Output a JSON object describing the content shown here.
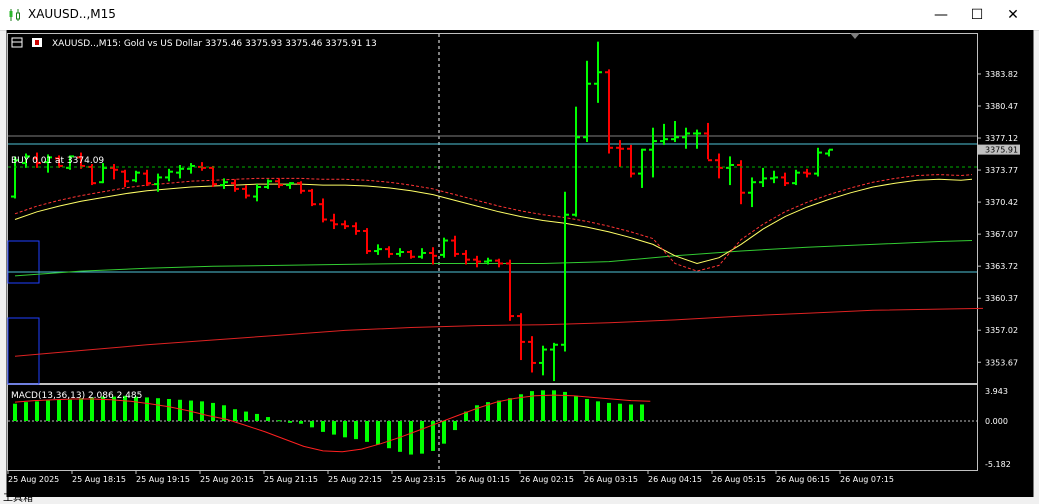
{
  "window": {
    "title": "XAUUSD..,M15",
    "minimize_label": "—",
    "maximize_label": "☐",
    "close_label": "✕"
  },
  "chart_header": {
    "symbol_line": "XAUUSD..,M15:  Gold vs US Dollar  3375.46 3375.93 3375.46 3375.91  13"
  },
  "trade_line": {
    "label": "BUY 0.01 at 3374.09",
    "price": 3374.09
  },
  "current_price_label": "3375.91",
  "price_axis_ticks": [
    "3383.82",
    "3380.47",
    "3377.12",
    "3373.77",
    "3370.42",
    "3367.07",
    "3363.72",
    "3360.37",
    "3357.02",
    "3353.67"
  ],
  "macd": {
    "label": "MACD(13,36,13) 2.086 2.485",
    "axis_ticks": [
      "3.943",
      "0.000",
      "-5.182"
    ]
  },
  "time_axis_ticks": [
    "25 Aug 2025",
    "25 Aug 18:15",
    "25 Aug 19:15",
    "25 Aug 20:15",
    "25 Aug 21:15",
    "25 Aug 22:15",
    "25 Aug 23:15",
    "26 Aug 01:15",
    "26 Aug 02:15",
    "26 Aug 03:15",
    "26 Aug 04:15",
    "26 Aug 05:15",
    "26 Aug 06:15",
    "26 Aug 07:15"
  ],
  "bottom_bar_text": "工具箱",
  "colors": {
    "bull": "#00ff00",
    "bear": "#ff0000",
    "ma_yellow": "#ffff66",
    "ma_green": "#33cc33",
    "ma_red": "#dd2222",
    "cyan_line": "#4fc3d9",
    "grid_dash": "#00b000"
  },
  "chart_data": {
    "type": "ohlc",
    "y_range": [
      3351.5,
      3388.0
    ],
    "bars": [
      {
        "o": 3371.0,
        "h": 3375.2,
        "l": 3370.8,
        "c": 3374.8
      },
      {
        "o": 3374.5,
        "h": 3375.5,
        "l": 3374.0,
        "c": 3375.2
      },
      {
        "o": 3375.0,
        "h": 3375.6,
        "l": 3374.0,
        "c": 3374.5
      },
      {
        "o": 3374.6,
        "h": 3375.4,
        "l": 3373.5,
        "c": 3375.1
      },
      {
        "o": 3375.0,
        "h": 3375.3,
        "l": 3374.0,
        "c": 3374.2
      },
      {
        "o": 3374.0,
        "h": 3375.3,
        "l": 3373.8,
        "c": 3375.2
      },
      {
        "o": 3375.1,
        "h": 3375.6,
        "l": 3373.9,
        "c": 3374.2
      },
      {
        "o": 3374.1,
        "h": 3374.4,
        "l": 3372.2,
        "c": 3372.4
      },
      {
        "o": 3372.5,
        "h": 3374.5,
        "l": 3372.4,
        "c": 3374.0
      },
      {
        "o": 3374.0,
        "h": 3374.4,
        "l": 3372.8,
        "c": 3373.8
      },
      {
        "o": 3373.6,
        "h": 3373.8,
        "l": 3372.0,
        "c": 3372.6
      },
      {
        "o": 3372.7,
        "h": 3373.7,
        "l": 3372.5,
        "c": 3373.5
      },
      {
        "o": 3373.4,
        "h": 3373.8,
        "l": 3372.1,
        "c": 3372.4
      },
      {
        "o": 3372.3,
        "h": 3373.4,
        "l": 3371.5,
        "c": 3373.0
      },
      {
        "o": 3373.0,
        "h": 3373.9,
        "l": 3372.6,
        "c": 3373.6
      },
      {
        "o": 3373.5,
        "h": 3374.3,
        "l": 3372.9,
        "c": 3373.9
      },
      {
        "o": 3373.9,
        "h": 3374.5,
        "l": 3373.4,
        "c": 3374.2
      },
      {
        "o": 3374.1,
        "h": 3374.6,
        "l": 3373.7,
        "c": 3374.0
      },
      {
        "o": 3374.0,
        "h": 3374.2,
        "l": 3372.0,
        "c": 3372.3
      },
      {
        "o": 3372.2,
        "h": 3372.9,
        "l": 3371.8,
        "c": 3372.5
      },
      {
        "o": 3372.4,
        "h": 3372.8,
        "l": 3371.5,
        "c": 3371.8
      },
      {
        "o": 3371.8,
        "h": 3372.2,
        "l": 3370.8,
        "c": 3371.1
      },
      {
        "o": 3371.0,
        "h": 3372.3,
        "l": 3370.5,
        "c": 3372.0
      },
      {
        "o": 3372.0,
        "h": 3372.8,
        "l": 3371.8,
        "c": 3372.6
      },
      {
        "o": 3372.6,
        "h": 3372.9,
        "l": 3371.9,
        "c": 3372.2
      },
      {
        "o": 3372.2,
        "h": 3372.5,
        "l": 3371.8,
        "c": 3372.4
      },
      {
        "o": 3372.4,
        "h": 3372.6,
        "l": 3371.3,
        "c": 3371.6
      },
      {
        "o": 3371.6,
        "h": 3371.8,
        "l": 3370.0,
        "c": 3370.2
      },
      {
        "o": 3370.2,
        "h": 3370.8,
        "l": 3368.3,
        "c": 3368.6
      },
      {
        "o": 3368.5,
        "h": 3369.2,
        "l": 3367.6,
        "c": 3368.1
      },
      {
        "o": 3368.1,
        "h": 3368.5,
        "l": 3367.6,
        "c": 3367.9
      },
      {
        "o": 3367.9,
        "h": 3368.3,
        "l": 3367.0,
        "c": 3367.4
      },
      {
        "o": 3367.4,
        "h": 3367.7,
        "l": 3365.0,
        "c": 3365.3
      },
      {
        "o": 3365.3,
        "h": 3366.0,
        "l": 3364.9,
        "c": 3365.5
      },
      {
        "o": 3365.5,
        "h": 3365.8,
        "l": 3364.6,
        "c": 3365.0
      },
      {
        "o": 3365.0,
        "h": 3365.6,
        "l": 3364.7,
        "c": 3365.2
      },
      {
        "o": 3365.2,
        "h": 3365.4,
        "l": 3364.5,
        "c": 3364.7
      },
      {
        "o": 3364.7,
        "h": 3365.6,
        "l": 3364.5,
        "c": 3365.1
      },
      {
        "o": 3365.1,
        "h": 3365.7,
        "l": 3363.9,
        "c": 3364.8
      },
      {
        "o": 3364.9,
        "h": 3366.7,
        "l": 3364.6,
        "c": 3366.4
      },
      {
        "o": 3366.4,
        "h": 3366.9,
        "l": 3364.7,
        "c": 3365.0
      },
      {
        "o": 3365.0,
        "h": 3365.4,
        "l": 3363.9,
        "c": 3364.4
      },
      {
        "o": 3364.4,
        "h": 3364.8,
        "l": 3363.6,
        "c": 3364.2
      },
      {
        "o": 3364.2,
        "h": 3364.6,
        "l": 3363.9,
        "c": 3364.3
      },
      {
        "o": 3364.3,
        "h": 3364.5,
        "l": 3363.6,
        "c": 3364.0
      },
      {
        "o": 3364.0,
        "h": 3364.4,
        "l": 3358.0,
        "c": 3358.5
      },
      {
        "o": 3358.5,
        "h": 3358.8,
        "l": 3353.9,
        "c": 3355.8
      },
      {
        "o": 3355.8,
        "h": 3356.4,
        "l": 3352.6,
        "c": 3353.6
      },
      {
        "o": 3353.6,
        "h": 3355.4,
        "l": 3352.3,
        "c": 3355.0
      },
      {
        "o": 3355.0,
        "h": 3355.7,
        "l": 3351.7,
        "c": 3355.5
      },
      {
        "o": 3355.5,
        "h": 3371.5,
        "l": 3354.8,
        "c": 3369.1
      },
      {
        "o": 3369.1,
        "h": 3380.4,
        "l": 3368.9,
        "c": 3377.2
      },
      {
        "o": 3377.2,
        "h": 3385.2,
        "l": 3376.7,
        "c": 3382.8
      },
      {
        "o": 3382.8,
        "h": 3387.2,
        "l": 3380.8,
        "c": 3384.0
      },
      {
        "o": 3384.0,
        "h": 3384.3,
        "l": 3375.5,
        "c": 3376.1
      },
      {
        "o": 3376.1,
        "h": 3376.9,
        "l": 3374.1,
        "c": 3376.0
      },
      {
        "o": 3376.0,
        "h": 3376.4,
        "l": 3373.0,
        "c": 3373.4
      },
      {
        "o": 3373.4,
        "h": 3376.0,
        "l": 3371.9,
        "c": 3375.9
      },
      {
        "o": 3375.9,
        "h": 3378.2,
        "l": 3373.0,
        "c": 3376.8
      },
      {
        "o": 3376.8,
        "h": 3378.6,
        "l": 3376.4,
        "c": 3377.0
      },
      {
        "o": 3377.0,
        "h": 3378.9,
        "l": 3376.7,
        "c": 3377.2
      },
      {
        "o": 3377.2,
        "h": 3378.2,
        "l": 3376.0,
        "c": 3377.6
      },
      {
        "o": 3377.6,
        "h": 3378.0,
        "l": 3376.0,
        "c": 3377.6
      },
      {
        "o": 3377.6,
        "h": 3378.7,
        "l": 3374.9,
        "c": 3374.8
      },
      {
        "o": 3374.8,
        "h": 3375.5,
        "l": 3372.9,
        "c": 3374.0
      },
      {
        "o": 3374.0,
        "h": 3375.2,
        "l": 3372.2,
        "c": 3374.3
      },
      {
        "o": 3374.3,
        "h": 3374.8,
        "l": 3370.2,
        "c": 3371.4
      },
      {
        "o": 3371.4,
        "h": 3373.0,
        "l": 3369.9,
        "c": 3372.5
      },
      {
        "o": 3372.5,
        "h": 3374.0,
        "l": 3372.0,
        "c": 3372.9
      },
      {
        "o": 3372.9,
        "h": 3373.7,
        "l": 3372.4,
        "c": 3373.0
      },
      {
        "o": 3373.0,
        "h": 3373.5,
        "l": 3372.1,
        "c": 3372.4
      },
      {
        "o": 3372.4,
        "h": 3373.8,
        "l": 3372.2,
        "c": 3373.5
      },
      {
        "o": 3373.5,
        "h": 3373.9,
        "l": 3373.0,
        "c": 3373.4
      },
      {
        "o": 3373.4,
        "h": 3376.1,
        "l": 3373.1,
        "c": 3375.6
      },
      {
        "o": 3375.5,
        "h": 3375.9,
        "l": 3375.2,
        "c": 3375.9
      }
    ],
    "ma_yellow": [
      3368.6,
      3369.4,
      3370.0,
      3370.5,
      3370.9,
      3371.3,
      3371.6,
      3371.8,
      3372.0,
      3372.1,
      3372.2,
      3372.3,
      3372.3,
      3372.3,
      3372.2,
      3372.2,
      3372.1,
      3371.9,
      3371.6,
      3371.2,
      3370.6,
      3370.0,
      3369.4,
      3368.9,
      3368.5,
      3368.2,
      3367.8,
      3367.3,
      3366.7,
      3366.0,
      3364.8,
      3364.0,
      3364.6,
      3366.0,
      3367.6,
      3368.9,
      3369.9,
      3370.7,
      3371.4,
      3372.0,
      3372.4,
      3372.7,
      3372.8,
      3372.7,
      3372.8
    ],
    "ma_yellow_x": [
      0,
      2,
      4,
      6,
      8,
      10,
      12,
      14,
      16,
      18,
      20,
      22,
      24,
      26,
      28,
      30,
      32,
      34,
      36,
      38,
      40,
      42,
      44,
      46,
      48,
      50,
      52,
      54,
      56,
      58,
      60,
      62,
      64,
      66,
      68,
      70,
      72,
      74,
      76,
      78,
      80,
      82,
      84,
      86,
      87
    ],
    "ma_green": [
      3362.7,
      3363.2,
      3363.5,
      3363.7,
      3363.8,
      3363.9,
      3364.0,
      3364.0,
      3364.0,
      3364.2,
      3364.8,
      3365.3,
      3365.7,
      3366.0,
      3366.3,
      3366.4
    ],
    "ma_green_x": [
      0,
      6,
      12,
      18,
      24,
      30,
      36,
      42,
      48,
      54,
      60,
      66,
      72,
      78,
      84,
      87
    ],
    "ma_red": [
      3354.3,
      3354.9,
      3355.5,
      3356.0,
      3356.5,
      3357.0,
      3357.3,
      3357.5,
      3357.6,
      3357.8,
      3358.1,
      3358.5,
      3358.8,
      3359.1,
      3359.3
    ],
    "ma_red_x": [
      0,
      6,
      12,
      18,
      24,
      30,
      36,
      42,
      48,
      54,
      60,
      66,
      72,
      78,
      88
    ],
    "macd_hist": [
      2.2,
      2.4,
      2.5,
      2.6,
      2.7,
      2.7,
      2.9,
      3.0,
      3.1,
      3.1,
      3.2,
      3.1,
      3.0,
      2.9,
      2.8,
      2.7,
      2.6,
      2.5,
      2.3,
      2.0,
      1.5,
      1.2,
      0.9,
      0.5,
      0.1,
      -0.2,
      -0.3,
      -0.7,
      -1.2,
      -1.5,
      -1.8,
      -2.0,
      -2.3,
      -2.6,
      -3.0,
      -3.4,
      -3.7,
      -3.6,
      -3.3,
      -2.5,
      -1.0,
      1.2,
      2.0,
      2.4,
      2.6,
      2.9,
      3.4,
      3.8,
      3.9,
      3.9,
      3.7,
      3.2,
      2.8,
      2.5,
      2.3,
      2.2,
      2.1,
      2.1
    ],
    "macd_signal": [
      2.4,
      2.6,
      2.7,
      2.8,
      2.8,
      2.7,
      2.5,
      2.2,
      1.8,
      1.3,
      0.7,
      0.2,
      -0.5,
      -1.2,
      -2.0,
      -2.8,
      -3.3,
      -3.4,
      -3.1,
      -2.5,
      -1.8,
      -1.0,
      -0.2,
      0.7,
      1.6,
      2.4,
      2.9,
      3.2,
      3.3,
      3.2,
      3.0,
      2.8,
      2.6,
      2.5
    ]
  }
}
